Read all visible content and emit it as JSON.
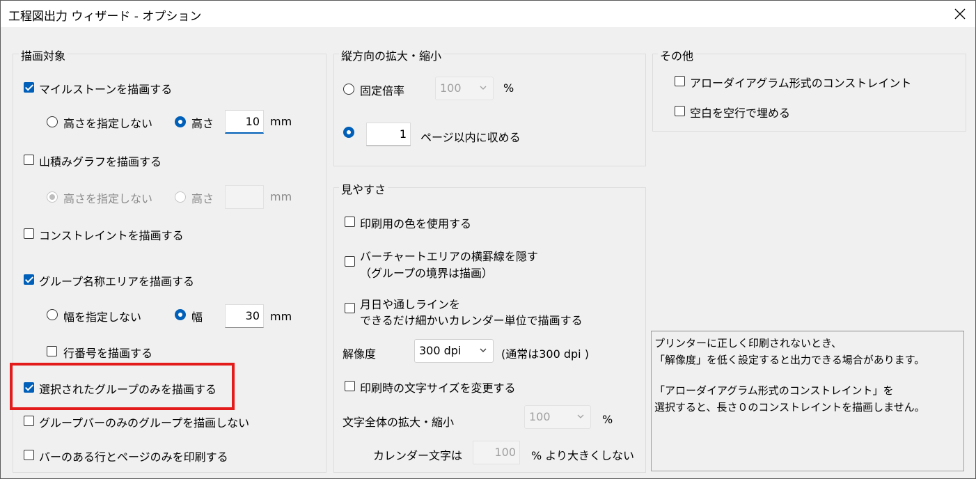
{
  "window": {
    "title": "工程図出力 ウィザード - オプション"
  },
  "draw_target": {
    "legend": "描画対象",
    "milestone": {
      "label": "マイルストーンを描画する",
      "checked": true
    },
    "milestone_height": {
      "no_height_label": "高さを指定しない",
      "height_label": "高さ",
      "value": "10",
      "unit": "mm"
    },
    "mountain_graph": {
      "label": "山積みグラフを描画する",
      "checked": false
    },
    "mountain_height": {
      "no_height_label": "高さを指定しない",
      "height_label": "高さ",
      "value": "",
      "unit": "mm"
    },
    "constraint": {
      "label": "コンストレイントを描画する",
      "checked": false
    },
    "group_name_area": {
      "label": "グループ名称エリアを描画する",
      "checked": true
    },
    "group_width": {
      "no_width_label": "幅を指定しない",
      "width_label": "幅",
      "value": "30",
      "unit": "mm"
    },
    "row_number": {
      "label": "行番号を描画する",
      "checked": false
    },
    "selected_groups_only": {
      "label": "選択されたグループのみを描画する",
      "checked": true
    },
    "skip_groupbar_only": {
      "label": "グループバーのみのグループを描画しない",
      "checked": false
    },
    "print_bar_rows_only": {
      "label": "バーのある行とページのみを印刷する",
      "checked": false
    }
  },
  "vertical_scale": {
    "legend": "縦方向の拡大・縮小",
    "fixed_ratio_label": "固定倍率",
    "fixed_ratio_value": "100",
    "fixed_ratio_unit": "%",
    "pages_value": "1",
    "pages_label": "ページ以内に収める"
  },
  "visibility": {
    "legend": "見やすさ",
    "print_colors": {
      "label": "印刷用の色を使用する",
      "checked": false
    },
    "hide_lines": {
      "line1": "バーチャートエリアの横罫線を隠す",
      "line2": "（グループの境界は描画）",
      "checked": false
    },
    "fine_calendar": {
      "line1": "月日や通しラインを",
      "line2": "できるだけ細かいカレンダー単位で描画する",
      "checked": false
    },
    "resolution_label": "解像度",
    "resolution_value": "300 dpi",
    "resolution_note": "(通常は300 dpi )",
    "change_font_size": {
      "label": "印刷時の文字サイズを変更する",
      "checked": false
    },
    "text_scale_label": "文字全体の拡大・縮小",
    "text_scale_value": "100",
    "text_scale_unit": "%",
    "calendar_text_label": "カレンダー文字は",
    "calendar_text_value": "100",
    "calendar_text_suffix": "% より大きくしない"
  },
  "other": {
    "legend": "その他",
    "arrow_diagram": {
      "label": "アローダイアグラム形式のコンストレイント",
      "checked": false
    },
    "fill_blank": {
      "label": "空白を空行で埋める",
      "checked": false
    }
  },
  "info": {
    "line1": "プリンターに正しく印刷されないとき、",
    "line2": "「解像度」を低く設定すると出力できる場合があります。",
    "line3": "「アローダイアグラム形式のコンストレイント」を",
    "line4": "選択すると、長さ０のコンストレイントを描画しません。"
  },
  "colors": {
    "accent": "#005fb8",
    "highlight": "#e41b1b"
  },
  "icons": {
    "close": "close-icon",
    "chevron": "chevron-down-icon"
  }
}
